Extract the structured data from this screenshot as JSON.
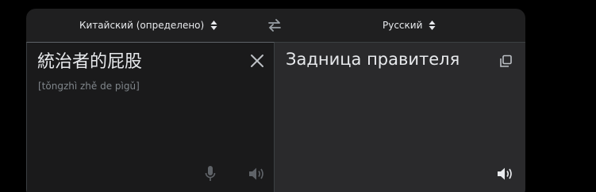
{
  "header": {
    "source_language": "Китайский (определено)",
    "target_language": "Русский"
  },
  "source": {
    "text": "統治者的屁股",
    "transliteration": "[tǒngzhì zhě de pìgǔ]"
  },
  "target": {
    "text": "Задница правителя"
  },
  "icons": {
    "source_dropdown": "updown-arrows-icon",
    "swap": "swap-icon",
    "target_dropdown": "updown-arrows-icon",
    "clear": "close-icon",
    "microphone": "microphone-icon",
    "source_speaker": "speaker-icon",
    "copy": "copy-icon",
    "target_speaker": "speaker-icon"
  },
  "colors": {
    "panel_background": "#1f1f20",
    "source_background": "#1a1a1b",
    "target_background": "#2a2a2c",
    "text": "#e8eaed",
    "muted": "#80868b"
  }
}
